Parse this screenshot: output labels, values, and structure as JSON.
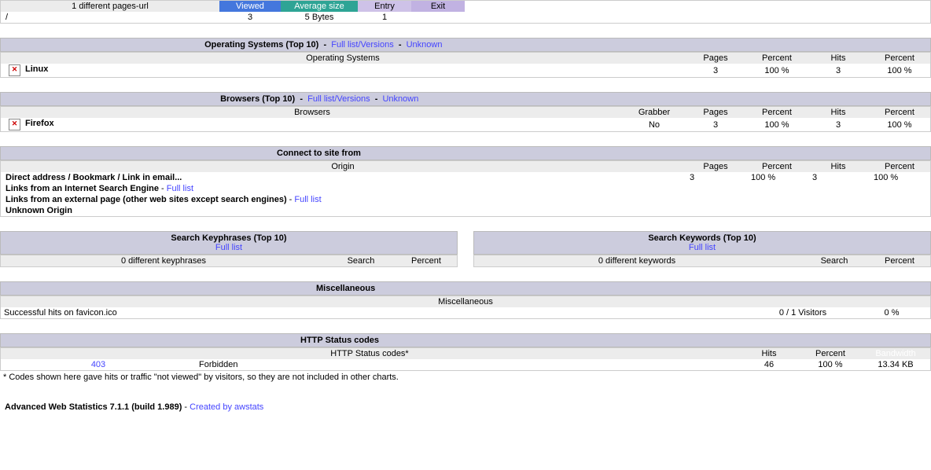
{
  "pagesUrl": {
    "heading": "1 different pages-url",
    "cols": {
      "viewed": "Viewed",
      "avgsize": "Average size",
      "entry": "Entry",
      "exit": "Exit"
    },
    "row": {
      "url": "/",
      "viewed": "3",
      "avgsize": "5 Bytes",
      "entry": "1",
      "exit": ""
    }
  },
  "os": {
    "title": "Operating Systems (Top 10)",
    "link1": "Full list/Versions",
    "link2": "Unknown",
    "colhdr": "Operating Systems",
    "cols": {
      "pages": "Pages",
      "percent": "Percent",
      "hits": "Hits",
      "percent2": "Percent"
    },
    "row": {
      "name": "Linux",
      "pages": "3",
      "percent": "100 %",
      "hits": "3",
      "percent2": "100 %"
    }
  },
  "browsers": {
    "title": "Browsers (Top 10)",
    "link1": "Full list/Versions",
    "link2": "Unknown",
    "colhdr": "Browsers",
    "cols": {
      "grabber": "Grabber",
      "pages": "Pages",
      "percent": "Percent",
      "hits": "Hits",
      "percent2": "Percent"
    },
    "row": {
      "name": "Firefox",
      "grabber": "No",
      "pages": "3",
      "percent": "100 %",
      "hits": "3",
      "percent2": "100 %"
    }
  },
  "connect": {
    "title": "Connect to site from",
    "colhdr": "Origin",
    "cols": {
      "pages": "Pages",
      "percent": "Percent",
      "hits": "Hits",
      "percent2": "Percent"
    },
    "rows": [
      {
        "label": "Direct address / Bookmark / Link in email...",
        "pages": "3",
        "percent": "100 %",
        "hits": "3",
        "percent2": "100 %"
      },
      {
        "label": "Links from an Internet Search Engine",
        "link": "Full list"
      },
      {
        "label": "Links from an external page (other web sites except search engines)",
        "link": "Full list"
      },
      {
        "label": "Unknown Origin"
      }
    ]
  },
  "keyphrases": {
    "title": "Search Keyphrases (Top 10)",
    "fulllist": "Full list",
    "subhdr": "0 different keyphrases",
    "cols": {
      "search": "Search",
      "percent": "Percent"
    }
  },
  "keywords": {
    "title": "Search Keywords (Top 10)",
    "fulllist": "Full list",
    "subhdr": "0 different keywords",
    "cols": {
      "search": "Search",
      "percent": "Percent"
    }
  },
  "misc": {
    "title": "Miscellaneous",
    "colhdr": "Miscellaneous",
    "row": {
      "label": "Successful hits on favicon.ico",
      "val": "0 / 1 Visitors",
      "pct": "0 %"
    }
  },
  "http": {
    "title": "HTTP Status codes",
    "colhdr": "HTTP Status codes*",
    "cols": {
      "hits": "Hits",
      "percent": "Percent",
      "bw": "Bandwidth"
    },
    "row": {
      "code": "403",
      "desc": "Forbidden",
      "hits": "46",
      "percent": "100 %",
      "bw": "13.34 KB"
    },
    "note": "* Codes shown here gave hits or traffic \"not viewed\" by visitors, so they are not included in other charts."
  },
  "footer": {
    "text": "Advanced Web Statistics 7.1.1 (build 1.989)",
    "link": "Created by awstats"
  }
}
